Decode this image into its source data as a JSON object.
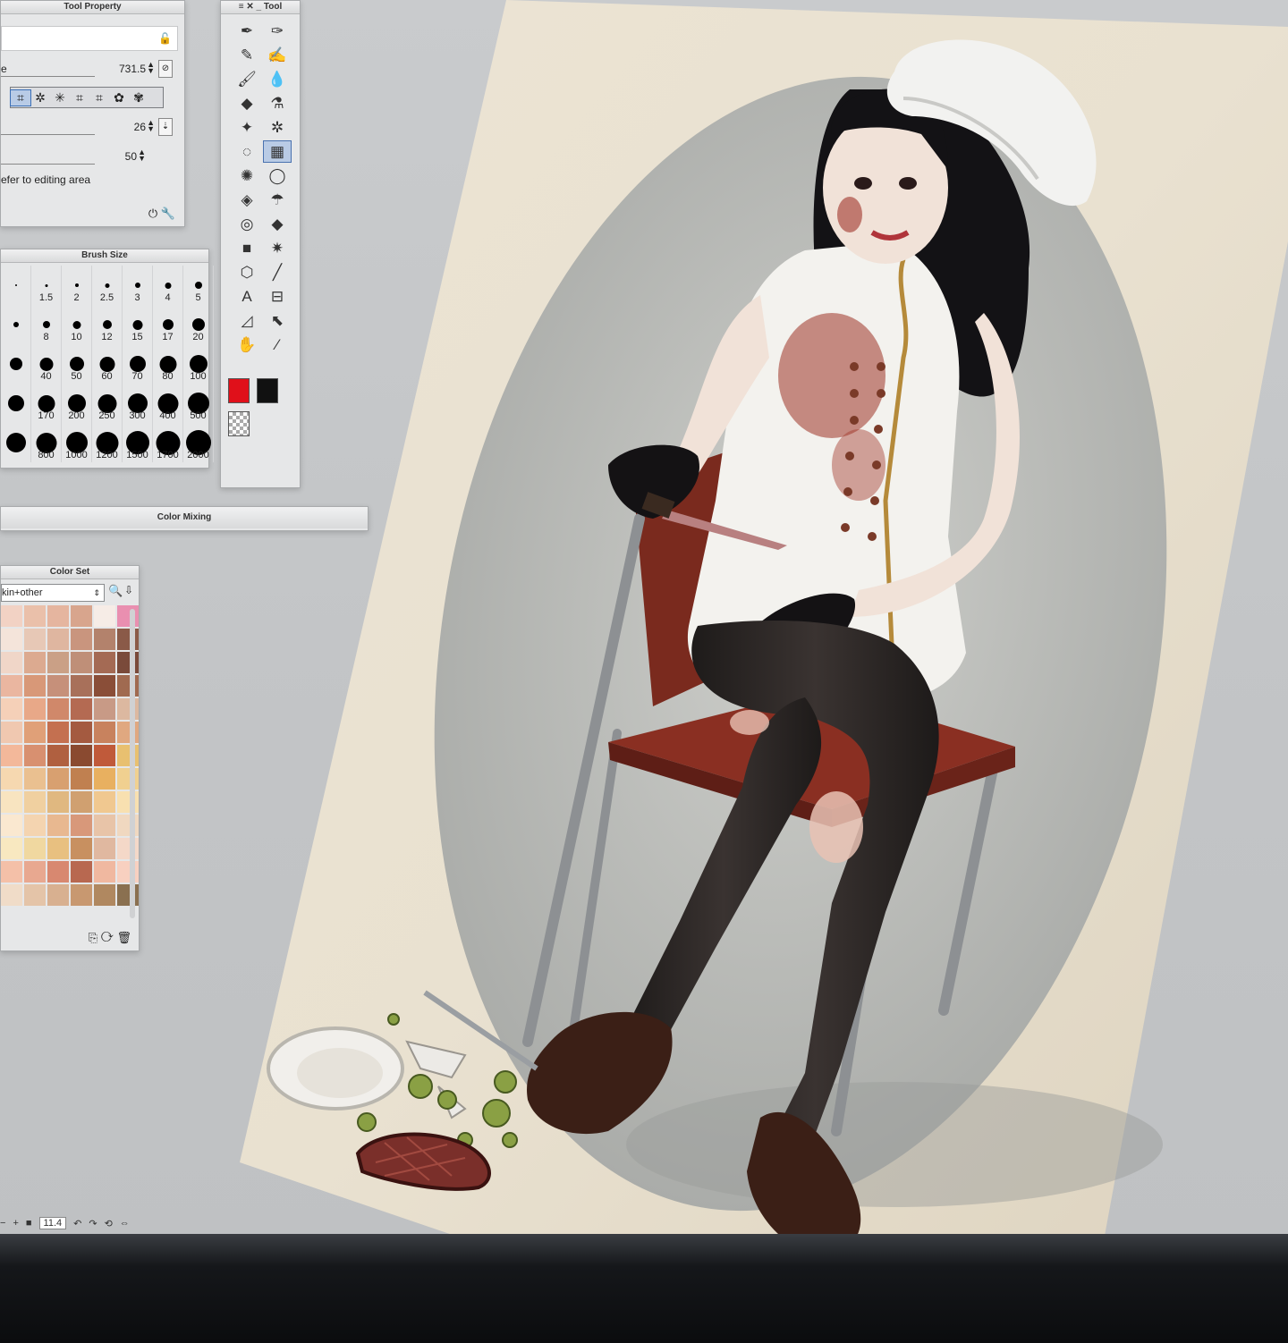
{
  "tool_property": {
    "title": "Tool Property",
    "size_label": "e",
    "size_value": "731.5",
    "density_value": "26",
    "opacity_value": "50",
    "note": "efer to editing area",
    "shape_icons": [
      "⌗",
      "✲",
      "✳",
      "⌗",
      "⌗",
      "✿",
      "✾"
    ]
  },
  "brush_size": {
    "title": "Brush Size",
    "sizes": [
      "",
      "1.5",
      "2",
      "2.5",
      "3",
      "4",
      "5",
      "",
      "8",
      "10",
      "12",
      "15",
      "17",
      "20",
      "",
      "40",
      "50",
      "60",
      "70",
      "80",
      "100",
      "",
      "170",
      "200",
      "250",
      "300",
      "400",
      "500",
      "",
      "800",
      "1000",
      "1200",
      "1500",
      "1700",
      "2000"
    ]
  },
  "tool_palette": {
    "title": "Tool",
    "colors": {
      "main": "#e0101a",
      "sub": "#111111"
    }
  },
  "color_mixing": {
    "title": "Color Mixing"
  },
  "color_set": {
    "title": "Color Set",
    "selected_set": "kin+other",
    "swatches": [
      "#f2d2c4",
      "#eac0aa",
      "#e5b59f",
      "#d8a58d",
      "#f6ece6",
      "#e98fb0",
      "#f4e4da",
      "#e7c8b6",
      "#dfb6a0",
      "#c9957e",
      "#b3826c",
      "#8a5a48",
      "#f0d6c8",
      "#dcaa90",
      "#caa086",
      "#bf8f78",
      "#a46a54",
      "#7a4a3a",
      "#eab6a0",
      "#d89878",
      "#c6907a",
      "#a8705a",
      "#8a4e38",
      "#a06a50",
      "#f5d0b8",
      "#e8a888",
      "#d0886a",
      "#b46a52",
      "#c89a86",
      "#dcb8a0",
      "#f0c8b0",
      "#e0a078",
      "#c47050",
      "#a45a40",
      "#c8825e",
      "#e0a880",
      "#f3b89a",
      "#d89070",
      "#b06040",
      "#8a4a30",
      "#c05a3a",
      "#e8c070",
      "#f6d8b0",
      "#eac090",
      "#d8a070",
      "#c08050",
      "#e8b060",
      "#f0d090",
      "#f8e4c0",
      "#f0d0a0",
      "#e0b880",
      "#d0a070",
      "#f0c890",
      "#f8e0b0",
      "#fae8d0",
      "#f4d4b0",
      "#e8b890",
      "#d8987a",
      "#e8c4a8",
      "#f0d8c0",
      "#f8e8c0",
      "#f0d8a0",
      "#e8c080",
      "#c89060",
      "#e0b8a0",
      "#f4d8c8",
      "#f4c0a8",
      "#e8a890",
      "#d88870",
      "#b86850",
      "#f0b8a0",
      "#f8d0c0",
      "#f0dcc8",
      "#e4c4a8",
      "#d8b090",
      "#c89870",
      "#b08860",
      "#8a7050"
    ]
  },
  "status_bar": {
    "zoom": "11.4"
  }
}
